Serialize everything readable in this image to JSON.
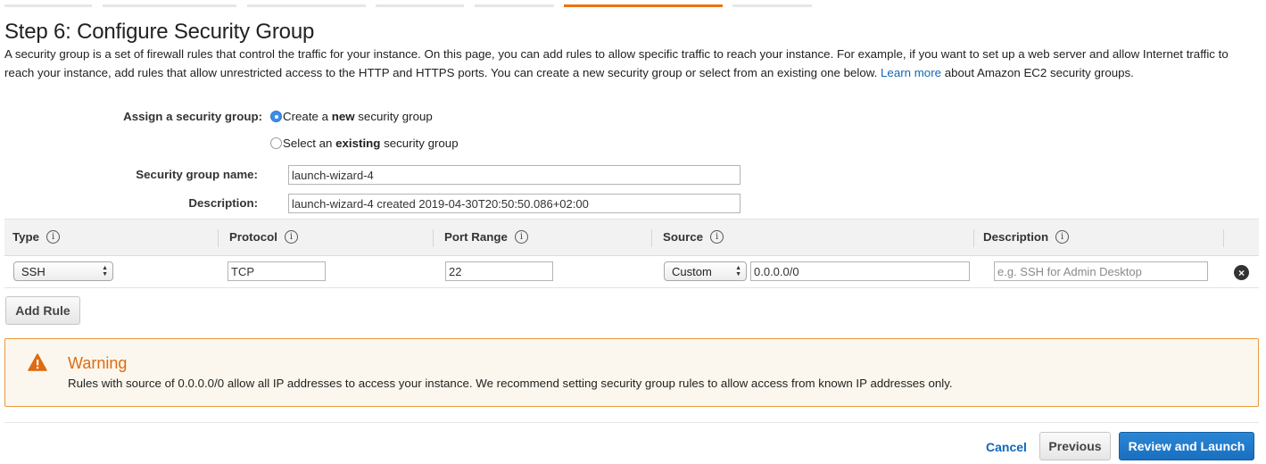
{
  "page": {
    "title": "Step 6: Configure Security Group",
    "intro_text": "A security group is a set of firewall rules that control the traffic for your instance. On this page, you can add rules to allow specific traffic to reach your instance. For example, if you want to set up a web server and allow Internet traffic to reach your instance, add rules that allow unrestricted access to the HTTP and HTTPS ports. You can create a new security group or select from an existing one below.",
    "learn_more_link": "Learn more",
    "intro_tail": "about Amazon EC2 security groups."
  },
  "assign": {
    "label": "Assign a security group:",
    "option_new_pre": "Create a ",
    "option_new_bold": "new",
    "option_new_post": " security group",
    "option_existing_pre": "Select an ",
    "option_existing_bold": "existing",
    "option_existing_post": " security group",
    "selected": "new"
  },
  "group_name": {
    "label": "Security group name:",
    "value": "launch-wizard-4"
  },
  "group_description": {
    "label": "Description:",
    "value": "launch-wizard-4 created 2019-04-30T20:50:50.086+02:00"
  },
  "rules_table": {
    "columns": [
      "Type",
      "Protocol",
      "Port Range",
      "Source",
      "Description"
    ],
    "info_glyph": "i",
    "rows": [
      {
        "type": "SSH",
        "protocol": "TCP",
        "port_range": "22",
        "source_mode": "Custom",
        "source_cidr": "0.0.0.0/0",
        "description_placeholder": "e.g. SSH for Admin Desktop",
        "remove_glyph": "×"
      }
    ]
  },
  "add_rule_button": "Add Rule",
  "warning": {
    "title": "Warning",
    "message": "Rules with source of 0.0.0.0/0 allow all IP addresses to access your instance. We recommend setting security group rules to allow access from known IP addresses only."
  },
  "footer": {
    "cancel": "Cancel",
    "previous": "Previous",
    "review_launch": "Review and Launch"
  },
  "colors": {
    "accent_orange": "#ec7211",
    "link_blue": "#1166bb",
    "primary_button": "#1a6fbf",
    "warning_border": "#e89a3c",
    "warning_title": "#dd6b10"
  },
  "icons": {
    "info": "info-icon",
    "warning": "warning-triangle-icon",
    "remove": "remove-rule-icon",
    "select_arrows": "select-arrows-icon"
  }
}
